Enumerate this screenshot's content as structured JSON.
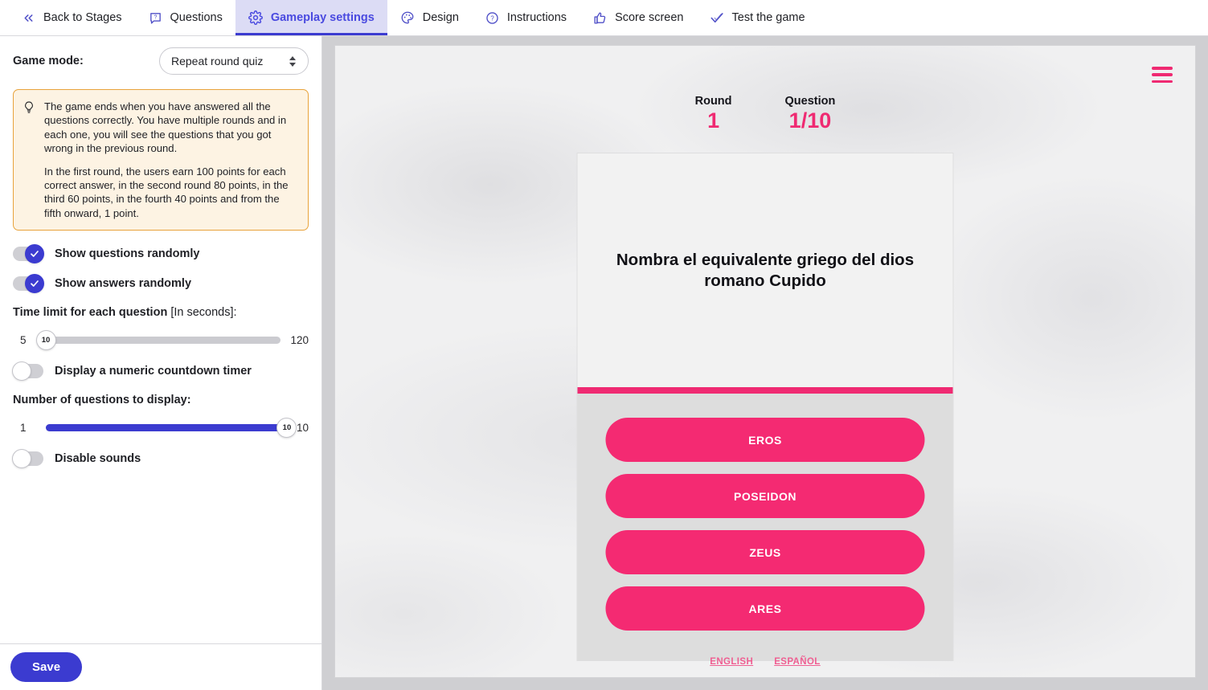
{
  "nav": {
    "tabs": [
      {
        "label": "Back to Stages",
        "icon": "chevron-double-left-icon",
        "active": false
      },
      {
        "label": "Questions",
        "icon": "question-bubble-icon",
        "active": false
      },
      {
        "label": "Gameplay settings",
        "icon": "gear-icon",
        "active": true
      },
      {
        "label": "Design",
        "icon": "palette-icon",
        "active": false
      },
      {
        "label": "Instructions",
        "icon": "question-circle-icon",
        "active": false
      },
      {
        "label": "Score screen",
        "icon": "thumbs-up-icon",
        "active": false
      },
      {
        "label": "Test the game",
        "icon": "check-icon",
        "active": false
      }
    ]
  },
  "settings": {
    "game_mode_label": "Game mode:",
    "game_mode_value": "Repeat round quiz",
    "info": {
      "icon": "lightbulb-icon",
      "paragraph1": "The game ends when you have answered all the questions correctly. You have multiple rounds and in each one, you will see the questions that you got wrong in the previous round.",
      "paragraph2": "In the first round, the users earn 100 points for each correct answer, in the second round 80 points, in the third 60 points, in the fourth 40 points and from the fifth onward, 1 point."
    },
    "toggles": {
      "show_questions_randomly": {
        "label": "Show questions randomly",
        "on": true
      },
      "show_answers_randomly": {
        "label": "Show answers randomly",
        "on": true
      },
      "numeric_countdown": {
        "label": "Display a numeric countdown timer",
        "on": false
      },
      "disable_sounds": {
        "label": "Disable sounds",
        "on": false
      }
    },
    "time_limit": {
      "title": "Time limit for each question",
      "title_suffix": "[In seconds]:",
      "min": "5",
      "max": "120",
      "value": "10",
      "fill_percent": 0
    },
    "question_count": {
      "title": "Number of questions to display:",
      "min": "1",
      "max": "10",
      "value": "10",
      "fill_percent": 100
    },
    "save_label": "Save"
  },
  "preview": {
    "menu_icon": "hamburger-menu-icon",
    "round_label": "Round",
    "round_value": "1",
    "question_label": "Question",
    "question_value": "1/10",
    "question_text": "Nombra el equivalente griego del dios romano Cupido",
    "answers": [
      "EROS",
      "POSEIDON",
      "ZEUS",
      "ARES"
    ],
    "languages": [
      "ENGLISH",
      "ESPAÑOL"
    ]
  },
  "colors": {
    "accent_blue": "#3b3bd0",
    "accent_pink": "#f42a72",
    "info_border": "#e8a33c",
    "info_bg": "#fdf3e3"
  }
}
